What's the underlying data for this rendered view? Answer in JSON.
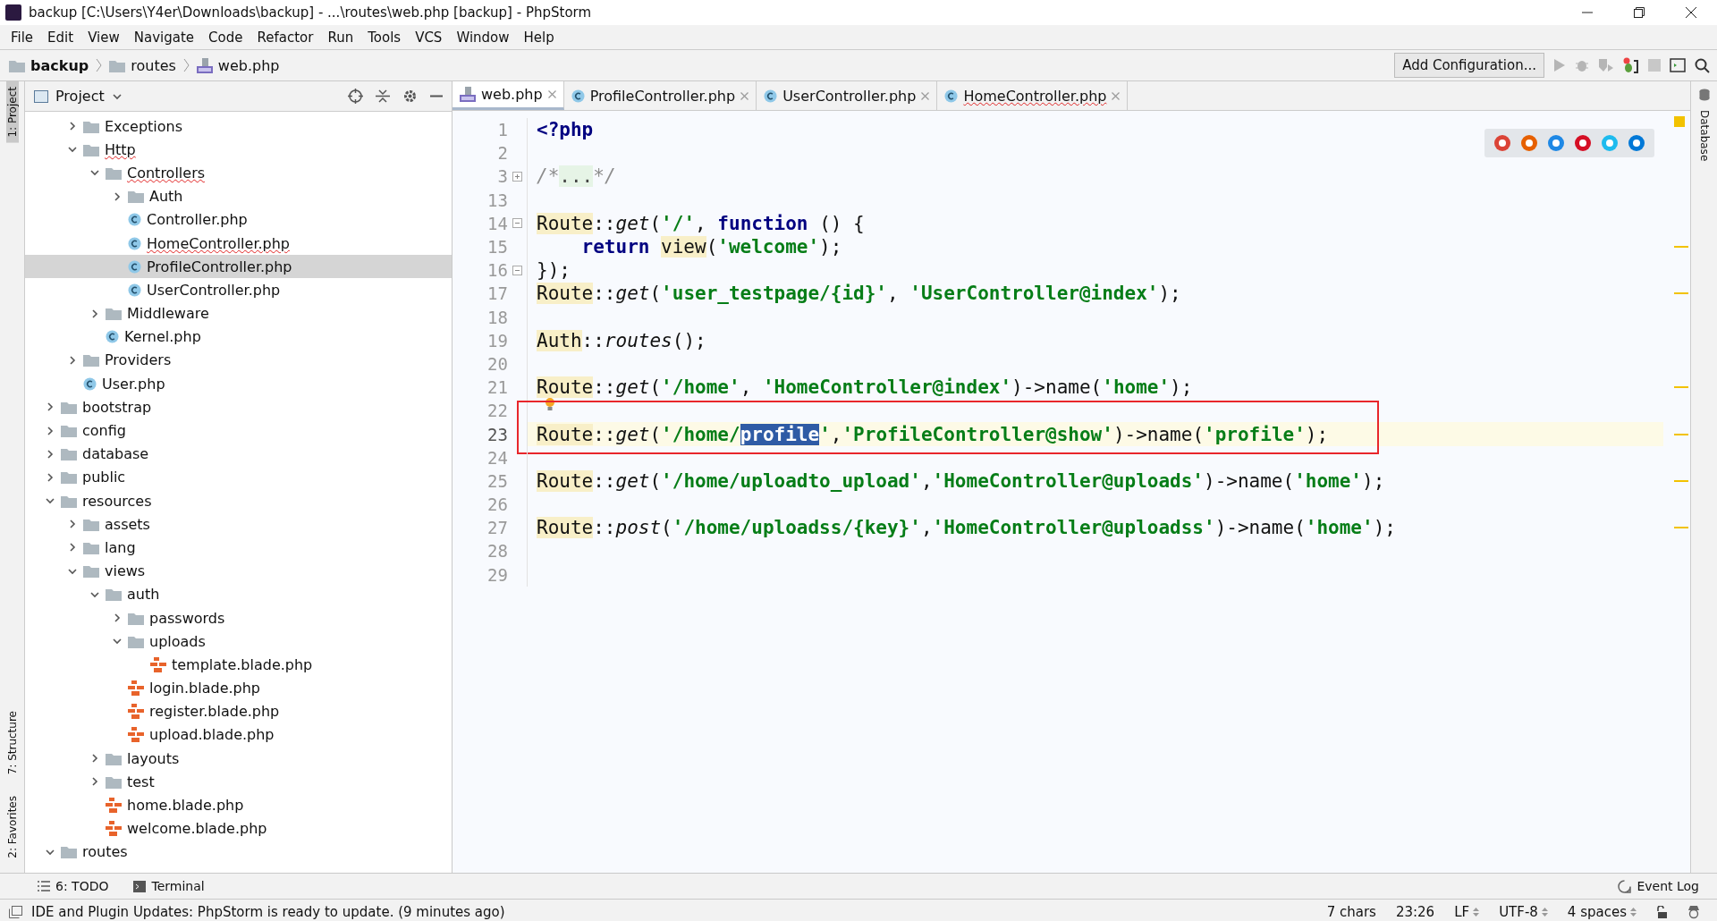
{
  "window": {
    "title": "backup [C:\\Users\\Y4er\\Downloads\\backup] - ...\\routes\\web.php [backup] - PhpStorm"
  },
  "menu": [
    "File",
    "Edit",
    "View",
    "Navigate",
    "Code",
    "Refactor",
    "Run",
    "Tools",
    "VCS",
    "Window",
    "Help"
  ],
  "breadcrumb": [
    {
      "label": "backup",
      "kind": "folder",
      "bold": true
    },
    {
      "label": "routes",
      "kind": "folder",
      "bold": false
    },
    {
      "label": "web.php",
      "kind": "php",
      "bold": false
    }
  ],
  "toolbar": {
    "config_button": "Add Configuration..."
  },
  "left_stripe": [
    {
      "label": "1: Project",
      "selected": true
    },
    {
      "label": "7: Structure",
      "selected": false
    },
    {
      "label": "2: Favorites",
      "selected": false
    }
  ],
  "right_stripe": [
    {
      "label": "Database",
      "selected": false
    }
  ],
  "project_panel": {
    "title": "Project",
    "scrolled_parent_children": [
      {
        "label": "Exceptions",
        "kind": "folder",
        "expanded": false,
        "selected": false,
        "error": false
      },
      {
        "label": "Http",
        "kind": "folder",
        "expanded": true,
        "selected": false,
        "error": true,
        "children": [
          {
            "label": "Controllers",
            "kind": "folder",
            "expanded": true,
            "selected": false,
            "error": true,
            "children": [
              {
                "label": "Auth",
                "kind": "folder",
                "expanded": false,
                "selected": false,
                "error": false
              },
              {
                "label": "Controller.php",
                "kind": "class",
                "selected": false,
                "error": false
              },
              {
                "label": "HomeController.php",
                "kind": "class",
                "selected": false,
                "error": true
              },
              {
                "label": "ProfileController.php",
                "kind": "class",
                "selected": true,
                "error": false
              },
              {
                "label": "UserController.php",
                "kind": "class",
                "selected": false,
                "error": false
              }
            ]
          },
          {
            "label": "Middleware",
            "kind": "folder",
            "expanded": false,
            "selected": false,
            "error": false
          },
          {
            "label": "Kernel.php",
            "kind": "class",
            "selected": false,
            "error": false
          }
        ]
      },
      {
        "label": "Providers",
        "kind": "folder",
        "expanded": false,
        "selected": false,
        "error": false
      },
      {
        "label": "User.php",
        "kind": "class",
        "selected": false,
        "error": false
      }
    ],
    "tree": [
      {
        "label": "bootstrap",
        "kind": "folder",
        "expanded": false,
        "selected": false,
        "error": false
      },
      {
        "label": "config",
        "kind": "folder",
        "expanded": false,
        "selected": false,
        "error": false
      },
      {
        "label": "database",
        "kind": "folder",
        "expanded": false,
        "selected": false,
        "error": false
      },
      {
        "label": "public",
        "kind": "folder",
        "expanded": false,
        "selected": false,
        "error": false
      },
      {
        "label": "resources",
        "kind": "folder",
        "expanded": true,
        "selected": false,
        "error": false,
        "children": [
          {
            "label": "assets",
            "kind": "folder",
            "expanded": false,
            "selected": false,
            "error": false
          },
          {
            "label": "lang",
            "kind": "folder",
            "expanded": false,
            "selected": false,
            "error": false
          },
          {
            "label": "views",
            "kind": "folder",
            "expanded": true,
            "selected": false,
            "error": false,
            "children": [
              {
                "label": "auth",
                "kind": "folder",
                "expanded": true,
                "selected": false,
                "error": false,
                "children": [
                  {
                    "label": "passwords",
                    "kind": "folder",
                    "expanded": false,
                    "selected": false,
                    "error": false
                  },
                  {
                    "label": "uploads",
                    "kind": "folder",
                    "expanded": true,
                    "selected": false,
                    "error": false,
                    "children": [
                      {
                        "label": "template.blade.php",
                        "kind": "blade",
                        "selected": false,
                        "error": false
                      }
                    ]
                  },
                  {
                    "label": "login.blade.php",
                    "kind": "blade",
                    "selected": false,
                    "error": false
                  },
                  {
                    "label": "register.blade.php",
                    "kind": "blade",
                    "selected": false,
                    "error": false
                  },
                  {
                    "label": "upload.blade.php",
                    "kind": "blade",
                    "selected": false,
                    "error": false
                  }
                ]
              },
              {
                "label": "layouts",
                "kind": "folder",
                "expanded": false,
                "selected": false,
                "error": false
              },
              {
                "label": "test",
                "kind": "folder",
                "expanded": false,
                "selected": false,
                "error": false
              },
              {
                "label": "home.blade.php",
                "kind": "blade",
                "selected": false,
                "error": false
              },
              {
                "label": "welcome.blade.php",
                "kind": "blade",
                "selected": false,
                "error": false
              }
            ]
          }
        ]
      },
      {
        "label": "routes",
        "kind": "folder",
        "expanded": true,
        "selected": false,
        "error": false
      }
    ]
  },
  "tabs": [
    {
      "label": "web.php",
      "kind": "php",
      "selected": true,
      "error": false
    },
    {
      "label": "ProfileController.php",
      "kind": "class",
      "selected": false,
      "error": false
    },
    {
      "label": "UserController.php",
      "kind": "class",
      "selected": false,
      "error": false
    },
    {
      "label": "HomeController.php",
      "kind": "class",
      "selected": false,
      "error": true
    }
  ],
  "editor": {
    "lines": [
      {
        "number": "1",
        "code": [
          {
            "kind": "keyword",
            "text": "<?php"
          }
        ]
      },
      {
        "number": "2"
      },
      {
        "number": "3",
        "collapsed": true,
        "code": [
          {
            "kind": "comment",
            "text": "/*"
          },
          {
            "kind": "folded",
            "text": "..."
          },
          {
            "kind": "comment",
            "text": "*/"
          }
        ]
      },
      {
        "number": "13"
      },
      {
        "number": "14",
        "fold_start": true,
        "code": [
          {
            "kind": "class",
            "text": "Route"
          },
          {
            "kind": "plain",
            "text": "::"
          },
          {
            "kind": "method",
            "text": "get"
          },
          {
            "kind": "plain",
            "text": "("
          },
          {
            "kind": "string",
            "text": "'/'"
          },
          {
            "kind": "plain",
            "text": ","
          },
          {
            "kind": "keyword",
            "text": "function",
            "space_before": true
          },
          {
            "kind": "plain",
            "text": "() {",
            "space_before": true
          }
        ]
      },
      {
        "number": "15",
        "indented": true,
        "warning": true,
        "code": [
          {
            "kind": "keyword",
            "text": "return"
          },
          {
            "kind": "class",
            "text": "view",
            "space_before": true
          },
          {
            "kind": "plain",
            "text": "("
          },
          {
            "kind": "string",
            "text": "'welcome'"
          },
          {
            "kind": "plain",
            "text": ");"
          }
        ]
      },
      {
        "number": "16",
        "fold_end": true,
        "code": [
          {
            "kind": "plain",
            "text": "});"
          }
        ]
      },
      {
        "number": "17",
        "warning": true,
        "code": [
          {
            "kind": "class",
            "text": "Route"
          },
          {
            "kind": "plain",
            "text": "::"
          },
          {
            "kind": "method",
            "text": "get"
          },
          {
            "kind": "plain",
            "text": "("
          },
          {
            "kind": "string",
            "text": "'user_testpage/{id}'"
          },
          {
            "kind": "plain",
            "text": ","
          },
          {
            "kind": "string",
            "text": "'UserController@index'",
            "space_before": true
          },
          {
            "kind": "plain",
            "text": ");"
          }
        ]
      },
      {
        "number": "18"
      },
      {
        "number": "19",
        "code": [
          {
            "kind": "class",
            "text": "Auth"
          },
          {
            "kind": "plain",
            "text": "::"
          },
          {
            "kind": "method",
            "text": "routes"
          },
          {
            "kind": "plain",
            "text": "();"
          }
        ]
      },
      {
        "number": "20"
      },
      {
        "number": "21",
        "warning": true,
        "code": [
          {
            "kind": "class",
            "text": "Route"
          },
          {
            "kind": "plain",
            "text": "::"
          },
          {
            "kind": "method",
            "text": "get"
          },
          {
            "kind": "plain",
            "text": "("
          },
          {
            "kind": "string",
            "text": "'/home'"
          },
          {
            "kind": "plain",
            "text": ","
          },
          {
            "kind": "string",
            "text": "'HomeController@index'",
            "space_before": true
          },
          {
            "kind": "plain",
            "text": ")->name("
          },
          {
            "kind": "string",
            "text": "'home'"
          },
          {
            "kind": "plain",
            "text": ");"
          }
        ]
      },
      {
        "number": "22",
        "bulb": true
      },
      {
        "number": "23",
        "current": true,
        "boxed": true,
        "warning": true,
        "code": [
          {
            "kind": "class",
            "text": "Route"
          },
          {
            "kind": "plain",
            "text": "::"
          },
          {
            "kind": "method",
            "text": "get"
          },
          {
            "kind": "plain",
            "text": "("
          },
          {
            "kind": "string",
            "text": "'/home/"
          },
          {
            "kind": "selection",
            "text": "profile"
          },
          {
            "kind": "string",
            "text": "'"
          },
          {
            "kind": "plain",
            "text": ","
          },
          {
            "kind": "string",
            "text": "'ProfileController@show'"
          },
          {
            "kind": "plain",
            "text": ")->name("
          },
          {
            "kind": "string",
            "text": "'profile'"
          },
          {
            "kind": "plain",
            "text": ");"
          }
        ]
      },
      {
        "number": "24"
      },
      {
        "number": "25",
        "warning": true,
        "code": [
          {
            "kind": "class",
            "text": "Route"
          },
          {
            "kind": "plain",
            "text": "::"
          },
          {
            "kind": "method",
            "text": "get"
          },
          {
            "kind": "plain",
            "text": "("
          },
          {
            "kind": "string",
            "text": "'/home/uploadto_upload'"
          },
          {
            "kind": "plain",
            "text": ","
          },
          {
            "kind": "string",
            "text": "'HomeController@uploads'"
          },
          {
            "kind": "plain",
            "text": ")->name("
          },
          {
            "kind": "string",
            "text": "'home'"
          },
          {
            "kind": "plain",
            "text": ");"
          }
        ]
      },
      {
        "number": "26"
      },
      {
        "number": "27",
        "warning": true,
        "code": [
          {
            "kind": "class",
            "text": "Route"
          },
          {
            "kind": "plain",
            "text": "::"
          },
          {
            "kind": "method",
            "text": "post"
          },
          {
            "kind": "plain",
            "text": "("
          },
          {
            "kind": "string",
            "text": "'/home/uploadss/{key}'"
          },
          {
            "kind": "plain",
            "text": ","
          },
          {
            "kind": "string",
            "text": "'HomeController@uploadss'"
          },
          {
            "kind": "plain",
            "text": ")->name("
          },
          {
            "kind": "string",
            "text": "'home'"
          },
          {
            "kind": "plain",
            "text": ");"
          }
        ]
      },
      {
        "number": "28"
      },
      {
        "number": "29"
      }
    ]
  },
  "tool_windows": {
    "left": [
      "6: TODO",
      "Terminal"
    ],
    "right": [
      "Event Log"
    ]
  },
  "status_bar": {
    "message": "IDE and Plugin Updates: PhpStorm is ready to update. (9 minutes ago)",
    "items": [
      "7 chars",
      "23:26",
      "LF",
      "UTF-8",
      "4 spaces"
    ],
    "dropdown_items": [
      false,
      false,
      true,
      true,
      true
    ]
  }
}
